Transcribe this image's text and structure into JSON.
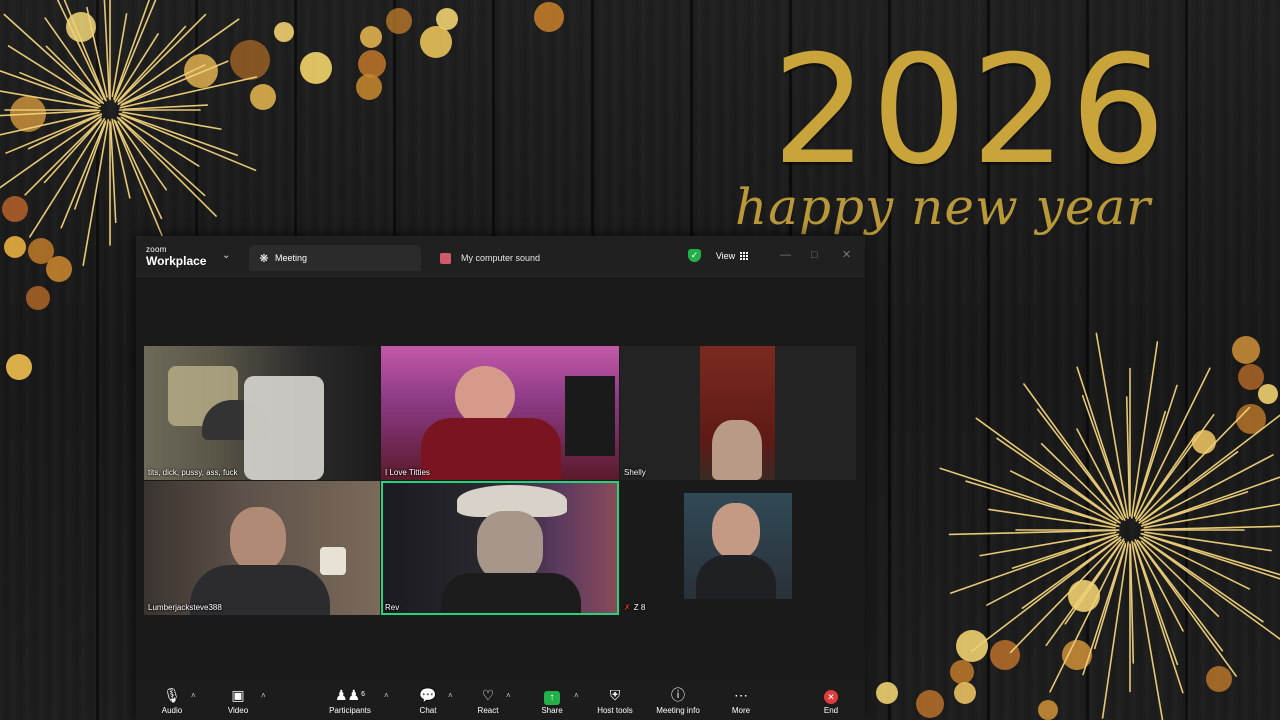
{
  "wallpaper": {
    "year": "2026",
    "greeting": "happy new year",
    "accent": "#c9a43a"
  },
  "app": {
    "brand_top": "zoom",
    "brand_bottom": "Workplace",
    "tabs": [
      {
        "label": "Meeting",
        "icon": "paw-icon"
      },
      {
        "label": "My computer sound",
        "icon": "sound-share-icon"
      }
    ],
    "view_label": "View",
    "window_controls": [
      "minimize",
      "maximize",
      "close"
    ]
  },
  "participants": [
    {
      "name": "tits, dick, pussy, ass, fuck",
      "muted": false,
      "active": false
    },
    {
      "name": "I Love Titties",
      "muted": false,
      "active": false
    },
    {
      "name": "Shelly",
      "muted": false,
      "active": false
    },
    {
      "name": "Lumberjacksteve388",
      "muted": false,
      "active": false
    },
    {
      "name": "Rev",
      "muted": false,
      "active": true
    },
    {
      "name": "Z 8",
      "muted": true,
      "active": false
    }
  ],
  "toolbar": {
    "audio": "Audio",
    "video": "Video",
    "participants": "Participants",
    "participants_count": "6",
    "chat": "Chat",
    "react": "React",
    "share": "Share",
    "host_tools": "Host tools",
    "meeting_info": "Meeting info",
    "more": "More",
    "end": "End",
    "end_color": "#e03b3b",
    "share_color": "#22b04b",
    "active_speaker_color": "#22d47b"
  }
}
